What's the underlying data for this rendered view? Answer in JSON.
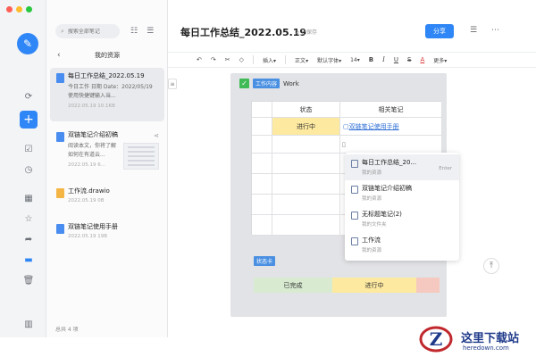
{
  "window": {
    "traffic_colors": [
      "#ff5f57",
      "#febc2e",
      "#28c840"
    ]
  },
  "rail": {
    "accent": "#2f86f6"
  },
  "list": {
    "search_placeholder": "搜索全部笔记",
    "panel_title": "我的资源",
    "files": [
      {
        "name": "每日工作总结_2022.05.19",
        "desc": "今日工作 日期 Date：2022/05/19 使用快捷键输入当...",
        "meta": "2022.05.19 10.1KB",
        "active": true
      },
      {
        "name": "双链笔记介绍初稿",
        "desc": "阅读本文，你将了解如何在有道云...",
        "meta": "2022.05.19 6...",
        "active": false
      },
      {
        "name": "工作流.drawio",
        "desc": "",
        "meta": "2022.05.19 0B",
        "active": false
      },
      {
        "name": "双链笔记使用手册",
        "desc": "",
        "meta": "2022.05.19 19B",
        "active": false
      }
    ],
    "total": "总共 4 项"
  },
  "doc": {
    "title": "每日工作总结_2022.05.19",
    "saved": "已保存",
    "share_label": "分享"
  },
  "toolbar": {
    "insert": "插入",
    "body_text": "正文",
    "font": "默认字体",
    "size": "14",
    "bold": "B",
    "italic": "I",
    "underline": "U",
    "strike": "S",
    "color": "A",
    "more": "更多"
  },
  "card": {
    "tag": "工作内容",
    "tag_label": "Work",
    "col_status": "状态",
    "col_notes": "相关笔记",
    "row1_status": "进行中",
    "row1_link": "双链笔记使用手册",
    "status_tag": "状态卡",
    "status_done": "已完成",
    "status_doing": "进行中"
  },
  "popup": {
    "items": [
      {
        "title": "每日工作总结_20...",
        "sub": "我的资源",
        "hint": "Enter"
      },
      {
        "title": "双链笔记介绍初稿",
        "sub": "我的资源",
        "hint": ""
      },
      {
        "title": "无标题笔记(2)",
        "sub": "我的文件夹",
        "hint": ""
      },
      {
        "title": "工作流",
        "sub": "我的资源",
        "hint": ""
      }
    ]
  },
  "watermark": {
    "name": "这里下载站",
    "url": "heredown.com"
  }
}
